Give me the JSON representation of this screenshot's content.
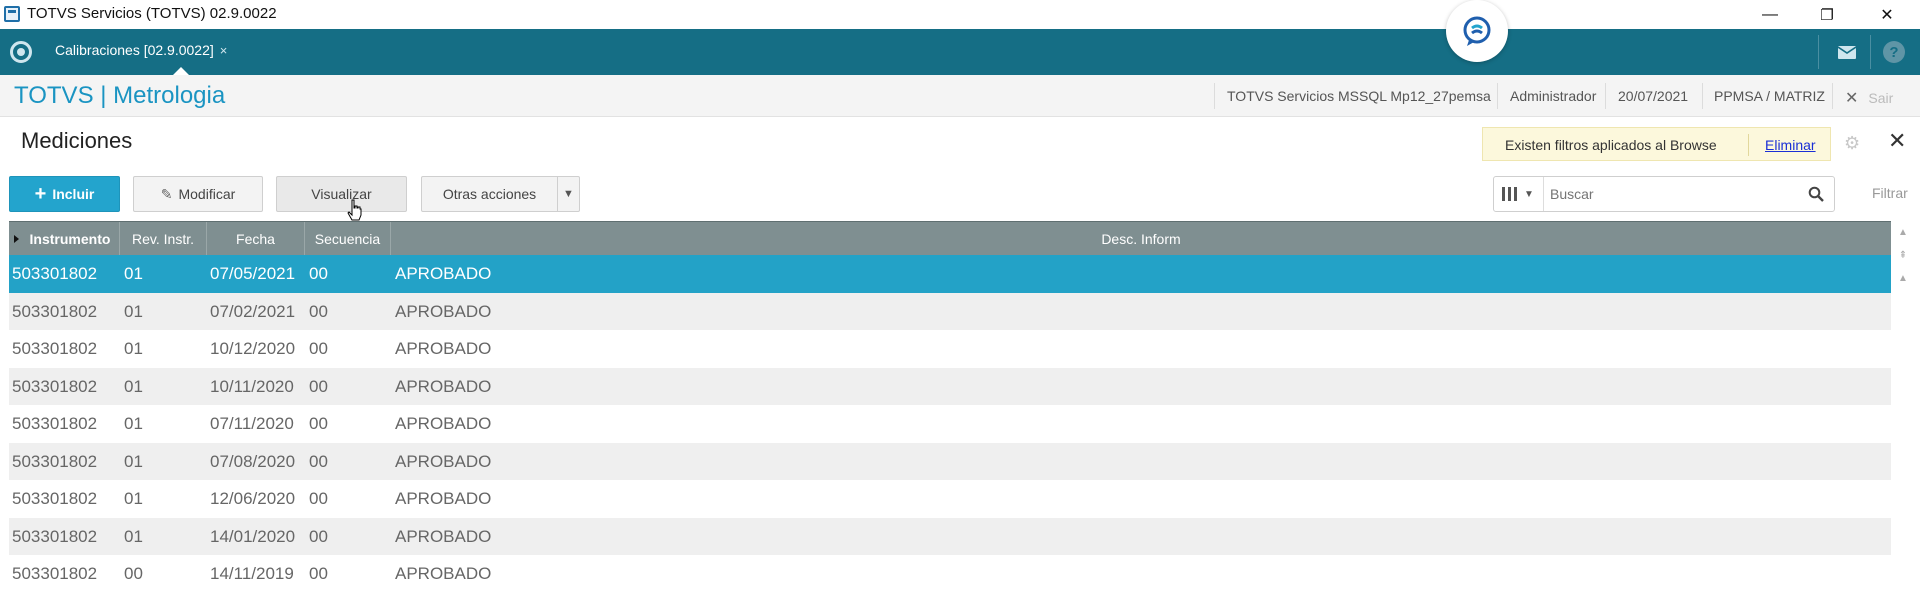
{
  "window": {
    "title": "TOTVS Servicios (TOTVS) 02.9.0022",
    "minimize": "—",
    "restore": "❐",
    "close": "✕"
  },
  "appbar": {
    "tab_label": "Calibraciones [02.9.0022]",
    "tab_close": "×",
    "help": "?"
  },
  "module": {
    "title": "TOTVS | Metrologia",
    "environment": "TOTVS Servicios MSSQL Mp12_27pemsa",
    "user": "Administrador",
    "date": "20/07/2021",
    "branch": "PPMSA / MATRIZ",
    "exit_label": "Sair"
  },
  "page": {
    "title": "Mediciones",
    "filter_notice": "Existen filtros aplicados al Browse",
    "filter_remove": "Eliminar"
  },
  "toolbar": {
    "include_label": "Incluir",
    "modify_label": "Modificar",
    "view_label": "Visualizar",
    "other_actions_label": "Otras acciones",
    "search_placeholder": "Buscar",
    "filter_label": "Filtrar"
  },
  "grid": {
    "columns": [
      "Instrumento",
      "Rev. Instr.",
      "Fecha",
      "Secuencia",
      "Desc. Inform"
    ],
    "rows": [
      [
        "503301802",
        "01",
        "07/05/2021",
        "00",
        "APROBADO"
      ],
      [
        "503301802",
        "01",
        "07/02/2021",
        "00",
        "APROBADO"
      ],
      [
        "503301802",
        "01",
        "10/12/2020",
        "00",
        "APROBADO"
      ],
      [
        "503301802",
        "01",
        "10/11/2020",
        "00",
        "APROBADO"
      ],
      [
        "503301802",
        "01",
        "07/11/2020",
        "00",
        "APROBADO"
      ],
      [
        "503301802",
        "01",
        "07/08/2020",
        "00",
        "APROBADO"
      ],
      [
        "503301802",
        "01",
        "12/06/2020",
        "00",
        "APROBADO"
      ],
      [
        "503301802",
        "01",
        "14/01/2020",
        "00",
        "APROBADO"
      ],
      [
        "503301802",
        "00",
        "14/11/2019",
        "00",
        "APROBADO"
      ]
    ],
    "selected_row": 0
  },
  "colors": {
    "appbar": "#156e85",
    "accent": "#1a94c2",
    "selected_row": "#23a2c7",
    "header": "#7f8f91"
  }
}
